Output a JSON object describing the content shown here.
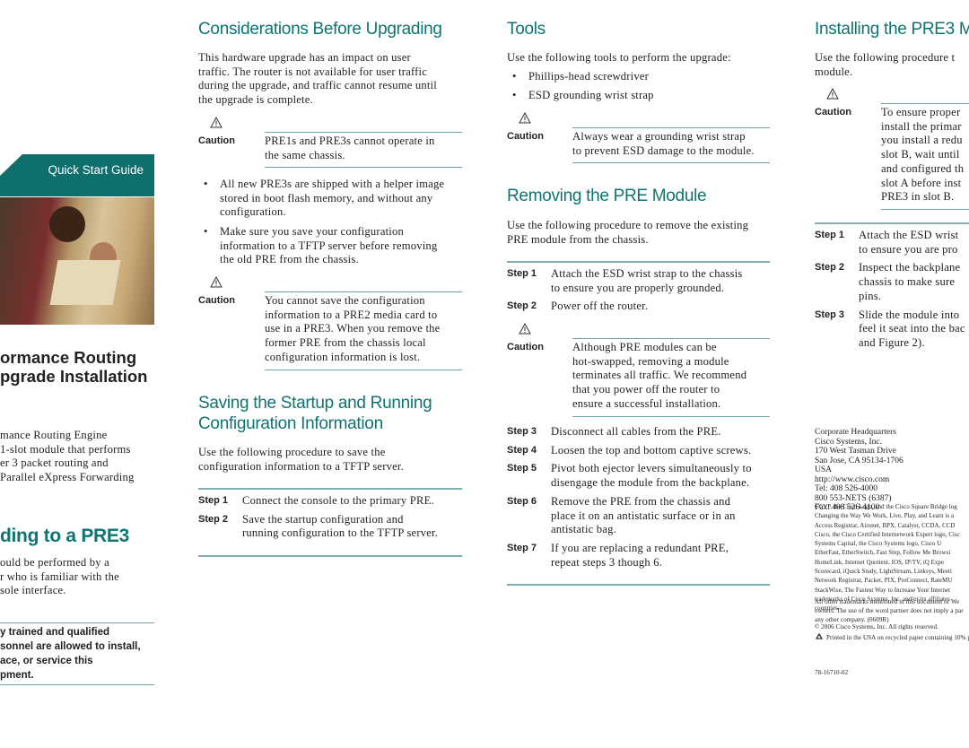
{
  "accent": "#0f7471",
  "cover": {
    "banner": "Quick Start Guide",
    "title": [
      "ormance Routing",
      "pgrade Installation"
    ],
    "intro": [
      "mance Routing Engine",
      "1-slot module that performs",
      "er 3 packet routing and",
      "Parallel eXpress Forwarding"
    ],
    "upgrade_heading": "ding to a PRE3",
    "upgrade_text": [
      "ould be performed by a",
      "r who is familiar with the",
      "sole interface."
    ],
    "warning": [
      "y trained and qualified",
      "sonnel are allowed to install,",
      "ace, or service this",
      "pment."
    ]
  },
  "considerations": {
    "heading": "Considerations Before Upgrading",
    "text": [
      "This hardware upgrade has an impact on user",
      "traffic. The router is not available for user traffic",
      "during the upgrade, and traffic cannot resume until",
      "the upgrade is complete."
    ],
    "caution_label": "Caution",
    "caution1": [
      "PRE1s and PRE3s cannot operate in",
      "the same chassis."
    ],
    "bullet1": [
      "All new PRE3s are shipped with a helper image",
      "stored in boot flash memory, and without any",
      "configuration."
    ],
    "bullet2": [
      "Make sure you save your configuration",
      "information to a TFTP server before removing",
      "the old PRE from the chassis."
    ],
    "caution2": [
      "You cannot save the configuration",
      "information to a PRE2 media card to",
      "use in a PRE3. When you remove the",
      "former PRE from the chassis local",
      "configuration information is lost."
    ]
  },
  "saving": {
    "heading": [
      "Saving the Startup and Running",
      "Configuration Information"
    ],
    "text": [
      "Use the following procedure to save the",
      "configuration information to a TFTP server."
    ],
    "steps": [
      {
        "label": "Step 1",
        "text": [
          "Connect the console to the primary PRE."
        ]
      },
      {
        "label": "Step 2",
        "text": [
          "Save the startup configuration and",
          "running configuration to the TFTP server."
        ]
      }
    ]
  },
  "tools": {
    "heading": "Tools",
    "text": [
      "Use the following tools to perform the upgrade:"
    ],
    "items": [
      "Phillips-head screwdriver",
      "ESD grounding wrist strap"
    ],
    "caution_label": "Caution",
    "caution": [
      "Always wear a grounding wrist strap",
      "to prevent ESD damage to the module."
    ]
  },
  "removing": {
    "heading": "Removing the PRE Module",
    "text": [
      "Use the following procedure to remove the existing",
      "PRE module from the chassis."
    ],
    "steps_a": [
      {
        "label": "Step 1",
        "text": [
          "Attach the ESD wrist strap to the chassis",
          "to ensure you are properly grounded."
        ]
      },
      {
        "label": "Step 2",
        "text": [
          "Power off the router."
        ]
      }
    ],
    "caution_label": "Caution",
    "caution": [
      "Although PRE modules can be",
      "hot-swapped, removing a module",
      "terminates all traffic. We recommend",
      "that you power off the router to",
      "ensure a successful installation."
    ],
    "steps_b": [
      {
        "label": "Step 3",
        "text": [
          "Disconnect all cables from the PRE."
        ]
      },
      {
        "label": "Step 4",
        "text": [
          "Loosen the top and bottom captive screws."
        ]
      },
      {
        "label": "Step 5",
        "text": [
          "Pivot both ejector levers simultaneously to",
          "disengage the module from the backplane."
        ]
      },
      {
        "label": "Step 6",
        "text": [
          "Remove the PRE from the chassis and",
          "place it on an antistatic surface or in an",
          "antistatic bag."
        ]
      },
      {
        "label": "Step 7",
        "text": [
          "If you are replacing a redundant PRE,",
          "repeat steps 3 though 6."
        ]
      }
    ]
  },
  "installing": {
    "heading": "Installing the PRE3 M",
    "text": [
      "Use the following procedure t",
      "module."
    ],
    "caution_label": "Caution",
    "caution": [
      "To ensure proper",
      "install the primar",
      "you install a redu",
      "slot B, wait until",
      "and configured th",
      "slot A before inst",
      "PRE3 in slot B."
    ],
    "steps": [
      {
        "label": "Step 1",
        "text": [
          "Attach the ESD wrist",
          "to ensure you are pro"
        ]
      },
      {
        "label": "Step 2",
        "text": [
          "Inspect the backplane",
          "chassis to make sure",
          "pins."
        ]
      },
      {
        "label": "Step 3",
        "text": [
          "Slide the module into",
          "feel it seat into the bac",
          "and Figure 2)."
        ]
      }
    ]
  },
  "footer": {
    "address": [
      "Corporate Headquarters",
      "Cisco Systems, Inc.",
      "170 West Tasman Drive",
      "San Jose, CA 95134-1706",
      "USA",
      "http://www.cisco.com",
      "Tel:    408 526-4000",
      "           800 553-NETS (6387)",
      "Fax:   408 526-4100"
    ],
    "trademarks": [
      "CCVP, the Cisco Logo, and the Cisco Square Bridge log",
      "Changing the Way We Work, Live, Play, and Learn is a",
      "Access Registrar, Aironet, BPX, Catalyst, CCDA, CCD",
      "Cisco, the Cisco Certified Internetwork Expert logo, Cisc",
      "Systems Capital, the Cisco Systems logo, Cisco U",
      "EtherFast, EtherSwitch, Fast Step, Follow Me Browsi",
      "HomeLink, Internet Quotient, IOS, IP/TV, iQ Expe",
      "Scorecard, iQuick Study, LightStream, Linksys, Meeti",
      "Network Registrar, Packet, PIX, ProConnect, RateMU",
      "StackWise, The Fastest Way to Increase Your Internet",
      "trademarks of Cisco Systems, Inc. and/or its affiliates",
      "countries."
    ],
    "other": [
      "All other trademarks mentioned in this document or We",
      "owners. The use of the word partner does not imply a par",
      "any other company. (0609R)"
    ],
    "copyright": "© 2006 Cisco Systems, Inc. All rights reserved.",
    "recycled": "Printed in the USA on recycled paper containing 10% p",
    "part_number": "78-16710-02"
  }
}
